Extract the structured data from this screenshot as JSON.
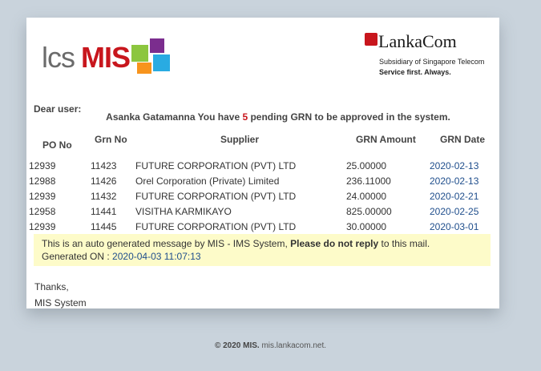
{
  "header": {
    "logo_left_part1": "lcs",
    "logo_left_part2": "MIS",
    "logo_right_name": "LankaCom",
    "logo_right_subtitle": "Subsidiary of Singapore Telecom",
    "logo_right_tagline": "Service first. Always.",
    "logo_squares_colors": [
      "#8cc63f",
      "#7b2d8e",
      "#f7941d",
      "#29abe2"
    ]
  },
  "greeting": "Dear user:",
  "message": {
    "before": "Asanka Gatamanna You have ",
    "count": "5",
    "after": " pending GRN to be approved in the system."
  },
  "table": {
    "headers": {
      "po_no": "PO No",
      "grn_no": "Grn No",
      "supplier": "Supplier",
      "grn_amount": "GRN Amount",
      "grn_date": "GRN Date"
    },
    "rows": [
      {
        "po": "12939",
        "grn": "11423",
        "supplier": "FUTURE CORPORATION (PVT) LTD",
        "amount": "25.00000",
        "date": "2020-02-13"
      },
      {
        "po": "12988",
        "grn": "11426",
        "supplier": "Orel Corporation (Private) Limited",
        "amount": "236.11000",
        "date": "2020-02-13"
      },
      {
        "po": "12939",
        "grn": "11432",
        "supplier": "FUTURE CORPORATION (PVT) LTD",
        "amount": "24.00000",
        "date": "2020-02-21"
      },
      {
        "po": "12958",
        "grn": "11441",
        "supplier": "VISITHA KARMIKAYO",
        "amount": "825.00000",
        "date": "2020-02-25"
      },
      {
        "po": "12939",
        "grn": "11445",
        "supplier": "FUTURE CORPORATION (PVT) LTD",
        "amount": "30.00000",
        "date": "2020-03-01"
      }
    ]
  },
  "notice": {
    "line1_start": "This is an auto generated message by MIS - IMS System, ",
    "line1_bold": "Please do not reply",
    "line1_end": " to this mail.",
    "generated_label": "Generated ON : ",
    "generated_value": "2020-04-03 11:07:13"
  },
  "signoff": {
    "thanks": "Thanks,",
    "sender": "MIS System"
  },
  "footer": {
    "copyright": "© 2020 MIS.",
    "domain": " mis.lankacom.net."
  }
}
